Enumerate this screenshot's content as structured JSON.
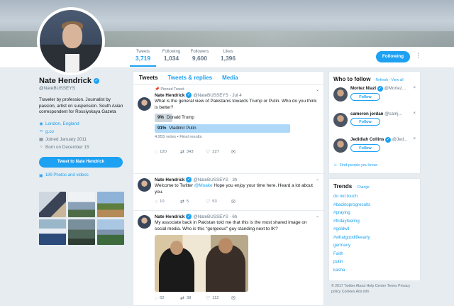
{
  "profile": {
    "name": "Nate Hendrick",
    "handle": "@NateBUSSEYS",
    "bio": "Traveler by profession. Journalist by passion, artist on suspension. South Asian correspondent for Rossiyskaya Gazeta",
    "location": "London, England",
    "website": "g.co",
    "joined": "Joined January 2011",
    "born": "Born on December 15",
    "tweet_to_button": "Tweet to Nate Hendrick",
    "photos_link": "189 Photos and videos"
  },
  "stats": [
    {
      "label": "Tweets",
      "value": "3,719"
    },
    {
      "label": "Following",
      "value": "1,034"
    },
    {
      "label": "Followers",
      "value": "9,600"
    },
    {
      "label": "Likes",
      "value": "1,396"
    }
  ],
  "following_button": "Following",
  "timeline": {
    "tabs": [
      "Tweets",
      "Tweets & replies",
      "Media"
    ],
    "tweets": [
      {
        "pinned": "Pinned Tweet",
        "name": "Nate Hendrick",
        "handle": "@NateBUSSEYS · Jul 4",
        "text": "What is the general view of Pakistanis towards Trump or Putin. Who do you think is better?",
        "poll": [
          {
            "pct": "9%",
            "label": "Donald Trump",
            "value": 0.09
          },
          {
            "pct": "91%",
            "label": "Vladimir Putin",
            "value": 0.91
          }
        ],
        "poll_meta": "4,955 votes • Final results",
        "replies": "120",
        "retweets": "343",
        "likes": "227"
      },
      {
        "name": "Nate Hendrick",
        "handle": "@NateBUSSEYS · 3h",
        "text_prefix": "Welcome to Twitter ",
        "mention": "@Moake",
        "text_suffix": " Hope you enjoy your time here. Heard a lot about you.",
        "replies": "10",
        "retweets": "5",
        "likes": "53"
      },
      {
        "name": "Nate Hendrick",
        "handle": "@NateBUSSEYS · 6h",
        "text": "My associate back in Pakistan told me that this is the most shared image on social media. Who is this \"gorgeous\" guy standing next to IK?",
        "replies": "62",
        "retweets": "38",
        "likes": "112"
      }
    ]
  },
  "who_to_follow": {
    "title": "Who to follow",
    "refresh": "· Refresh · View all",
    "follow_label": "Follow",
    "users": [
      {
        "name": "Mortez Niazi",
        "handle": "@Mortez..."
      },
      {
        "name": "cameron jordan",
        "handle": "@camj..."
      },
      {
        "name": "Jedidiah Collins",
        "handle": "@Jed..."
      }
    ],
    "find_people": "Find people you know"
  },
  "trends": {
    "title": "Trends",
    "change": "· Change",
    "items": [
      "do not touch",
      "#backtoprogresults",
      "#praying",
      "#fridayfeeling",
      "#goldwll",
      "#whatgoodlifeearly",
      "germany",
      "Faith",
      "putin",
      "kasha"
    ]
  },
  "footer": "© 2017 Twitter About Help Center Terms Privacy policy Cookies Ads info",
  "colors": {
    "accent": "#1da1f2",
    "background": "#e6ecf0"
  }
}
